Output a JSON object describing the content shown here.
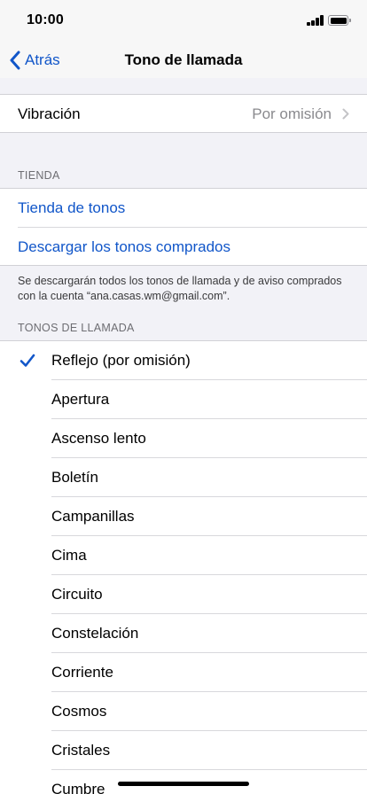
{
  "status_bar": {
    "time": "10:00",
    "icons": [
      "signal-icon",
      "battery-icon"
    ]
  },
  "nav": {
    "back_label": "Atrás",
    "back_icon": "chevron-left-icon",
    "title": "Tono de llamada"
  },
  "vibration": {
    "label": "Vibración",
    "value": "Por omisión",
    "icon": "chevron-right-icon"
  },
  "store": {
    "header": "TIENDA",
    "items": [
      {
        "label": "Tienda de tonos"
      },
      {
        "label": "Descargar los tonos comprados"
      }
    ],
    "footer": "Se descargarán todos los tonos de llamada y de aviso comprados con la cuenta “ana.casas.wm@gmail.com”."
  },
  "ringtones": {
    "header": "TONOS DE LLAMADA",
    "items": [
      {
        "label": "Reflejo (por omisión)",
        "selected": true
      },
      {
        "label": "Apertura",
        "selected": false
      },
      {
        "label": "Ascenso lento",
        "selected": false
      },
      {
        "label": "Boletín",
        "selected": false
      },
      {
        "label": "Campanillas",
        "selected": false
      },
      {
        "label": "Cima",
        "selected": false
      },
      {
        "label": "Circuito",
        "selected": false
      },
      {
        "label": "Constelación",
        "selected": false
      },
      {
        "label": "Corriente",
        "selected": false
      },
      {
        "label": "Cosmos",
        "selected": false
      },
      {
        "label": "Cristales",
        "selected": false
      },
      {
        "label": "Cumbre",
        "selected": false
      }
    ]
  },
  "colors": {
    "accent": "#1156c9",
    "grouped_background": "#f2f2f7",
    "secondary_text": "#8a8a8e"
  }
}
